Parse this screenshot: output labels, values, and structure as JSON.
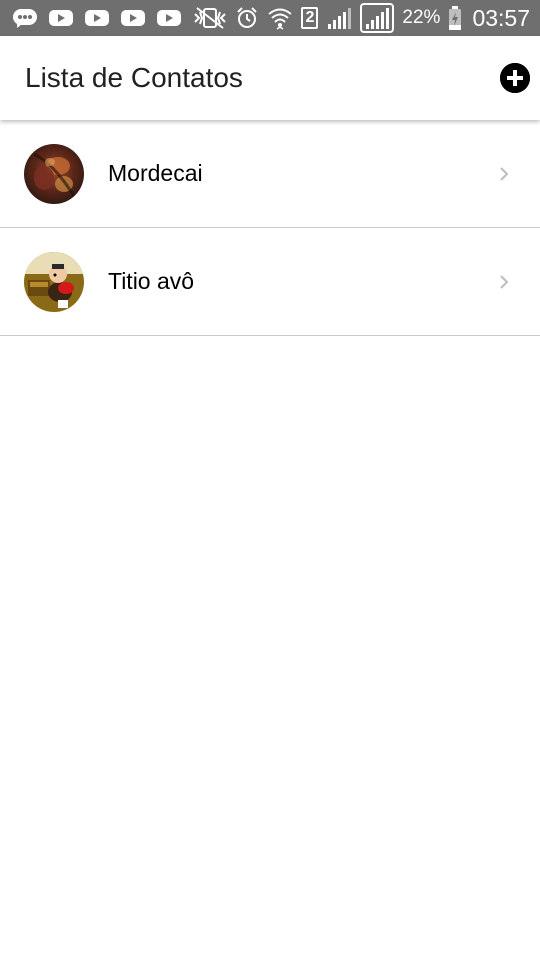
{
  "status_bar": {
    "battery_percent": "22%",
    "time": "03:57",
    "sim_slot": "2",
    "icons": [
      "chat-bubble-icon",
      "youtube-icon",
      "youtube-icon",
      "youtube-icon",
      "youtube-icon",
      "vibrate-mute-icon",
      "alarm-icon",
      "wifi-icon",
      "sim-2-icon",
      "signal-icon",
      "signal-icon",
      "battery-charging-icon"
    ]
  },
  "app_bar": {
    "title": "Lista de Contatos",
    "add_icon": "add-circle-icon"
  },
  "contacts": [
    {
      "name": "Mordecai",
      "avatar": "avatar-photo",
      "chevron": "chevron-right-icon"
    },
    {
      "name": "Titio avô",
      "avatar": "avatar-photo",
      "chevron": "chevron-right-icon"
    }
  ],
  "colors": {
    "status_bar": "#6f6f6f",
    "app_bar": "#ffffff",
    "divider": "#c8c8c8",
    "title_text": "#212121",
    "add_button": "#000000",
    "chevron": "#bdbdbd"
  }
}
